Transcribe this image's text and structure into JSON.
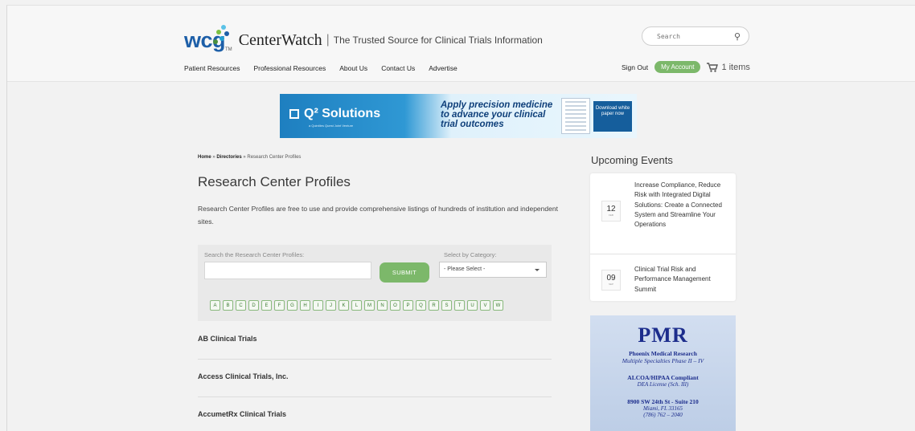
{
  "header": {
    "logo_wcg": "wcg",
    "logo_tm": "TM",
    "logo_centerwatch": "CenterWatch",
    "separator": "|",
    "tagline": "The Trusted Source for Clinical Trials Information",
    "search_placeholder": "Search",
    "nav": [
      "Patient Resources",
      "Professional Resources",
      "About Us",
      "Contact Us",
      "Advertise"
    ],
    "sign_out": "Sign Out",
    "my_account": "My Account",
    "cart": "1 items"
  },
  "banner": {
    "brand": "Q² Solutions",
    "brand_sub": "a Quintiles Quest Joint Venture",
    "message": "Apply precision medicine to advance your clinical trial outcomes",
    "cta": "Download white paper now"
  },
  "breadcrumb": {
    "home": "Home",
    "sep1": " » ",
    "directories": "Directories",
    "sep2": " » ",
    "current": "Research Center Profiles"
  },
  "page": {
    "title": "Research Center Profiles",
    "description": "Research Center Profiles are free to use and provide comprehensive listings of hundreds of institution and independent sites."
  },
  "search_panel": {
    "search_label": "Search the Research Center Profiles:",
    "submit_label": "SUBMIT",
    "category_label": "Select by Category:",
    "category_selected": "- Please Select -",
    "letters": [
      "A",
      "B",
      "C",
      "D",
      "E",
      "F",
      "G",
      "H",
      "I",
      "J",
      "K",
      "L",
      "M",
      "N",
      "O",
      "P",
      "Q",
      "R",
      "S",
      "T",
      "U",
      "V",
      "W"
    ]
  },
  "results": [
    "AB Clinical Trials",
    "Access Clinical Trials, Inc.",
    "AccumetRx Clinical Trials"
  ],
  "sidebar": {
    "title": "Upcoming Events",
    "events": [
      {
        "day": "12",
        "month": "FEB",
        "title": "Increase Compliance, Reduce Risk with Integrated Digital Solutions: Create a Connected System and Streamline Your Operations"
      },
      {
        "day": "09",
        "month": "SEP",
        "title": "Clinical Trial Risk and Performance Management Summit"
      }
    ],
    "ad": {
      "logo": "PMR",
      "name": "Phoenix Medical Research",
      "specialties": "Multiple Specialties Phase II – IV",
      "compliance": "ALCOA/HIPAA Compliant",
      "license": "DEA License (Sch. III)",
      "address": "8900 SW 24th St - Suite 210",
      "city": "Miami, FL 33165",
      "phone": "(786) 762 – 2040"
    }
  },
  "colors": {
    "accent_green": "#7cb86a",
    "logo_blue": "#1d5fa8",
    "pmr_blue": "#1c2d8c"
  }
}
